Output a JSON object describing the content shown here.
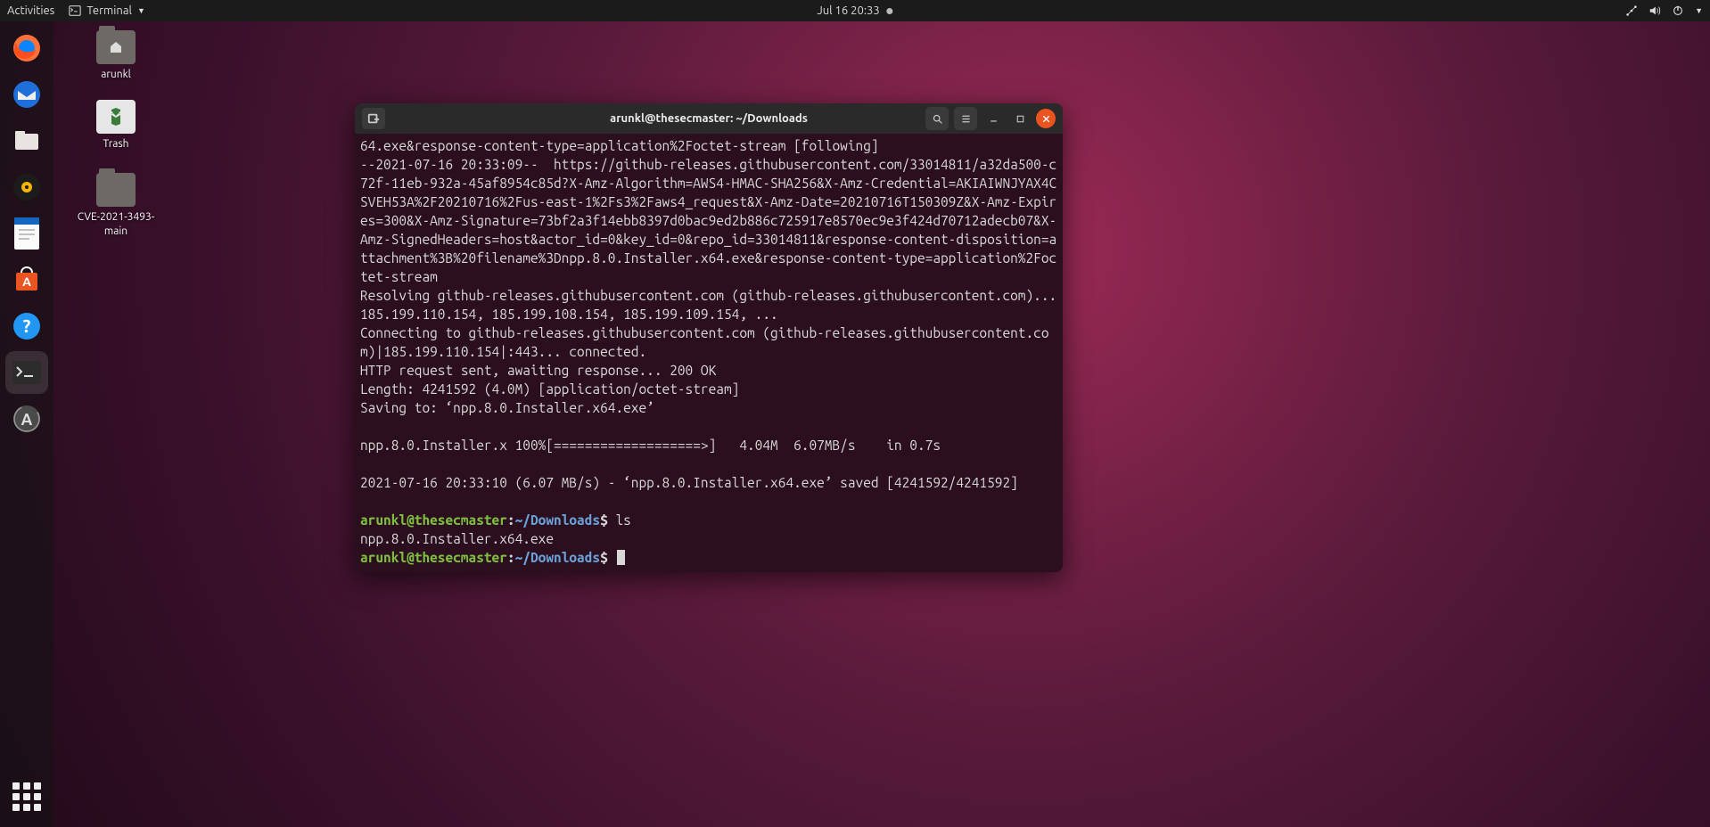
{
  "topbar": {
    "activities": "Activities",
    "app_label": "Terminal",
    "clock": "Jul 16  20:33"
  },
  "desktop_icons": {
    "home": "arunkl",
    "trash": "Trash",
    "cve": "CVE-2021-3493-main"
  },
  "terminal": {
    "title": "arunkl@thesecmaster: ~/Downloads",
    "output": "64.exe&response-content-type=application%2Foctet-stream [following]\n--2021-07-16 20:33:09--  https://github-releases.githubusercontent.com/33014811/a32da500-c72f-11eb-932a-45af8954c85d?X-Amz-Algorithm=AWS4-HMAC-SHA256&X-Amz-Credential=AKIAIWNJYAX4CSVEH53A%2F20210716%2Fus-east-1%2Fs3%2Faws4_request&X-Amz-Date=20210716T150309Z&X-Amz-Expires=300&X-Amz-Signature=73bf2a3f14ebb8397d0bac9ed2b886c725917e8570ec9e3f424d70712adecb07&X-Amz-SignedHeaders=host&actor_id=0&key_id=0&repo_id=33014811&response-content-disposition=attachment%3B%20filename%3Dnpp.8.0.Installer.x64.exe&response-content-type=application%2Foctet-stream\nResolving github-releases.githubusercontent.com (github-releases.githubusercontent.com)... 185.199.110.154, 185.199.108.154, 185.199.109.154, ...\nConnecting to github-releases.githubusercontent.com (github-releases.githubusercontent.com)|185.199.110.154|:443... connected.\nHTTP request sent, awaiting response... 200 OK\nLength: 4241592 (4.0M) [application/octet-stream]\nSaving to: ‘npp.8.0.Installer.x64.exe’\n\nnpp.8.0.Installer.x 100%[===================>]   4.04M  6.07MB/s    in 0.7s\n\n2021-07-16 20:33:10 (6.07 MB/s) - ‘npp.8.0.Installer.x64.exe’ saved [4241592/4241592]\n",
    "prompt_user": "arunkl@thesecmaster",
    "prompt_path": "~/Downloads",
    "cmd_ls": "ls",
    "ls_output": "npp.8.0.Installer.x64.exe"
  }
}
